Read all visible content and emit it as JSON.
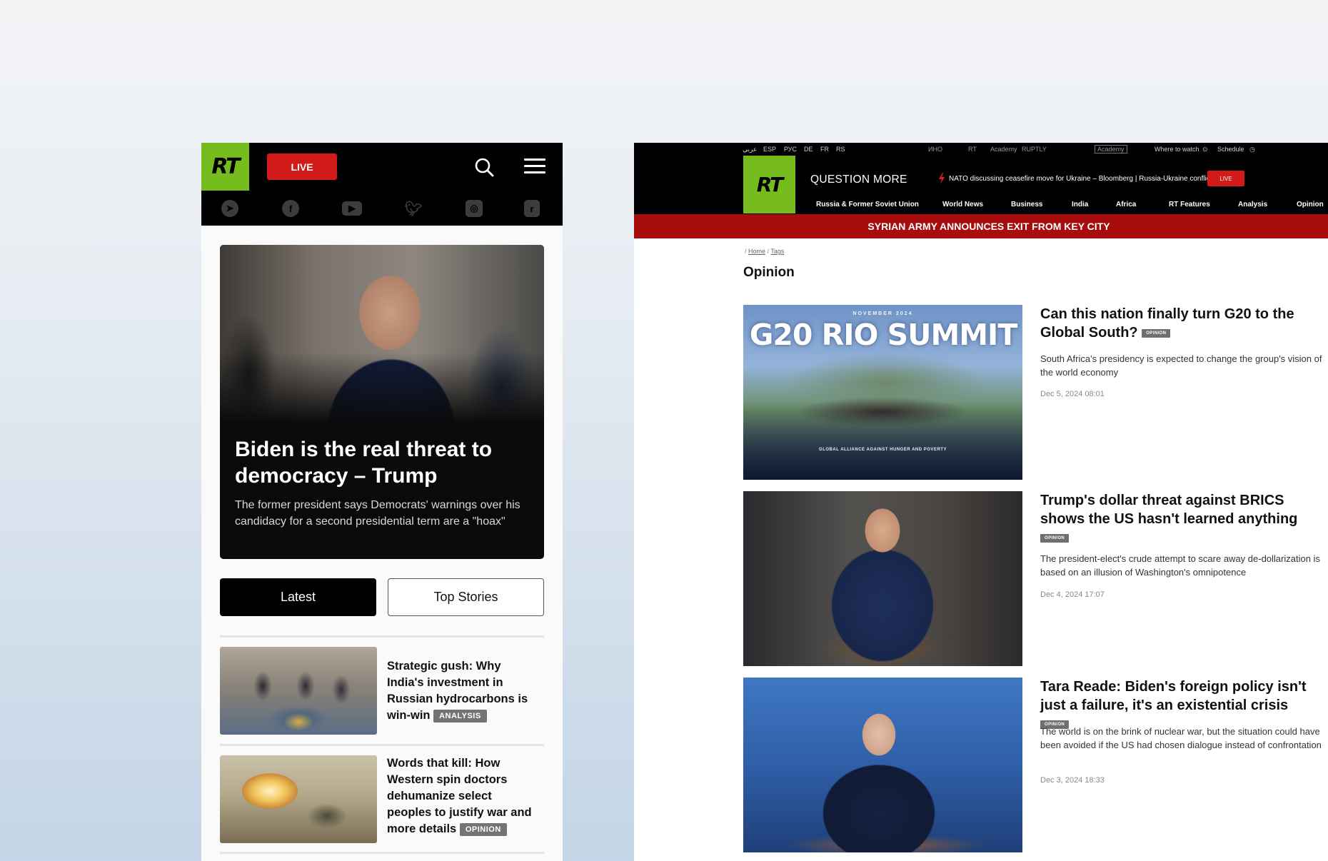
{
  "mobile": {
    "logo": "RT",
    "live_label": "LIVE",
    "social": [
      "telegram-icon",
      "facebook-icon",
      "youtube-icon",
      "twitter-icon",
      "instagram-icon",
      "rumble-icon"
    ],
    "hero": {
      "title": "Biden is the real threat to democracy – Trump",
      "description": "The former president says Democrats' warnings over his candidacy for a second presidential term are a \"hoax\""
    },
    "tabs": {
      "latest": "Latest",
      "top_stories": "Top Stories"
    },
    "items": [
      {
        "title": "Strategic gush: Why India's investment in Russian hydrocarbons is win-win",
        "badge": "ANALYSIS"
      },
      {
        "title": "Words that kill: How Western spin doctors dehumanize select peoples to justify war and more details",
        "badge": "OPINION"
      }
    ]
  },
  "desktop": {
    "strip": {
      "languages": [
        "عربي",
        "ESP",
        "РУС",
        "DE",
        "FR",
        "RS"
      ],
      "brands": [
        "ИНО",
        "RT",
        "RUPTLY",
        "Academy"
      ],
      "where_to_watch": "Where to watch",
      "schedule": "Schedule"
    },
    "header": {
      "logo": "RT",
      "tagline": "QUESTION MORE",
      "ticker": "NATO discussing ceasefire move for Ukraine – Bloomberg | Russia-Ukraine conflict",
      "live_label": "LIVE",
      "nav": [
        "Russia & Former Soviet Union",
        "World News",
        "Business",
        "India",
        "Africa",
        "RT Features",
        "Analysis",
        "Opinion"
      ]
    },
    "breaking": "SYRIAN ARMY ANNOUNCES EXIT FROM KEY CITY",
    "breadcrumbs": [
      "Home",
      "Tags"
    ],
    "page_title": "Opinion",
    "image_texts": {
      "g20_top": "NOVEMBER 2024",
      "g20_title": "G20 RIO SUMMIT",
      "g20_band": "GLOBAL ALLIANCE AGAINST HUNGER AND POVERTY"
    },
    "articles": [
      {
        "title": "Can this nation finally turn G20 to the Global South?",
        "badge": "OPINION",
        "description": "South Africa's presidency is expected to change the group's vision of the world economy",
        "date": "Dec 5, 2024 08:01"
      },
      {
        "title": "Trump's dollar threat against BRICS shows the US hasn't learned anything",
        "badge": "OPINION",
        "description": "The president-elect's crude attempt to scare away de-dollarization is based on an illusion of Washington's omnipotence",
        "date": "Dec 4, 2024 17:07"
      },
      {
        "title": "Tara Reade: Biden's foreign policy isn't just a failure, it's an existential crisis",
        "badge": "OPINION",
        "description": "The world is on the brink of nuclear war, but the situation could have been avoided if the US had chosen dialogue instead of confrontation",
        "date": "Dec 3, 2024 18:33"
      }
    ]
  },
  "colors": {
    "brand_green": "#77bc1f",
    "live_red": "#d11a1a",
    "breaking_red": "#a70d0d"
  }
}
